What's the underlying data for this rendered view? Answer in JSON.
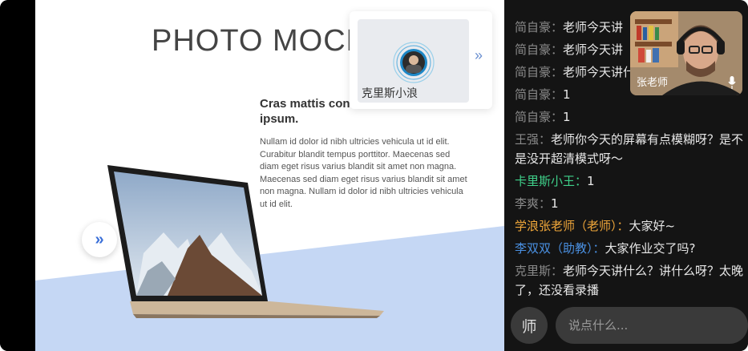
{
  "slide": {
    "title": "PHOTO MOCK-",
    "subheading": "Cras mattis cons fermentum lorem ipsum.",
    "body": "Nullam id dolor id nibh ultricies vehicula ut id elit. Curabitur blandit tempus porttitor. Maecenas sed diam eget risus varius blandit sit amet non magna. Maecenas sed diam eget risus varius blandit sit amet non magna. Nullam id dolor id nibh ultricies vehicula ut id elit.",
    "next_icon": "»"
  },
  "speaker_card": {
    "name": "克里斯小浪",
    "collapse_icon": "»"
  },
  "video": {
    "name": "张老师"
  },
  "chat": {
    "messages": [
      {
        "who": "简自豪：",
        "text": "老师今天讲",
        "who_color": "#8a8a8a"
      },
      {
        "who": "简自豪：",
        "text": "老师今天讲",
        "who_color": "#8a8a8a"
      },
      {
        "who": "简自豪：",
        "text": "老师今天讲什么？",
        "who_color": "#8a8a8a"
      },
      {
        "who": "简自豪：",
        "text": "1",
        "who_color": "#8a8a8a"
      },
      {
        "who": "简自豪：",
        "text": "1",
        "who_color": "#8a8a8a"
      },
      {
        "who": "王强：",
        "text": "老师你今天的屏幕有点模糊呀？是不是没开超清模式呀～",
        "who_color": "#8a8a8a"
      },
      {
        "who": "卡里斯小王：",
        "text": "1",
        "who_color": "#3fd08a"
      },
      {
        "who": "李爽：",
        "text": "1",
        "who_color": "#8a8a8a"
      },
      {
        "who": "学浪张老师（老师）：",
        "text": "大家好~",
        "who_color": "#f0a73a"
      },
      {
        "who": "李双双（助教）：",
        "text": "大家作业交了吗?",
        "who_color": "#4a90e2"
      },
      {
        "who": "克里斯：",
        "text": "老师今天讲什么？讲什么呀？太晚了，还没看录播",
        "who_color": "#8a8a8a"
      }
    ],
    "teacher_badge": "师",
    "input_placeholder": "说点什么..."
  }
}
